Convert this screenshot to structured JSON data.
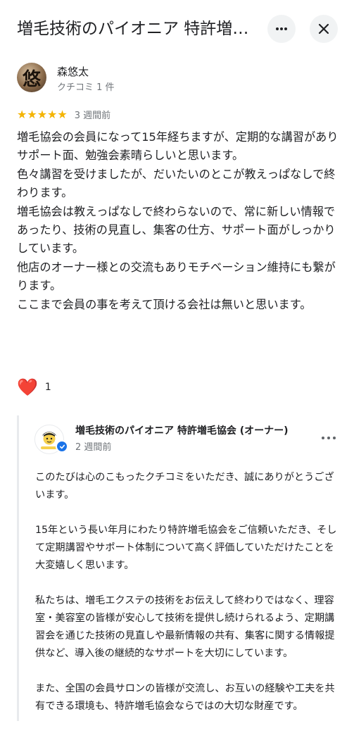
{
  "header": {
    "title": "増毛技術のパイオニア 特許増毛協会（オーナー）",
    "more_icon": "more-horizontal-icon",
    "close_icon": "close-icon"
  },
  "reviewer": {
    "avatar_text": "悠",
    "name": "森悠太",
    "count": "クチコミ 1 件"
  },
  "rating": {
    "stars": 5,
    "stars_text": "★★★★★",
    "date": "3 週間前"
  },
  "review": {
    "text": "増毛協会の会員になって15年経ちますが、定期的な講習がありサポート面、勉強会素晴らしいと思います。\n色々講習を受けましたが、だいたいのとこが教えっぱなしで終わります。\n増毛協会は教えっぱなしで終わらないので、常に新しい情報であったり、技術の見直し、集客の仕方、サポート面がしっかりしています。\n他店のオーナー様との交流もありモチベーション維持にも繋がります。\nここまで会員の事を考えて頂ける会社は無いと思います。"
  },
  "reaction": {
    "icon": "heart-icon",
    "count": "1"
  },
  "owner_reply": {
    "name": "増毛技術のパイオニア 特許増毛協会 (オーナー)",
    "date": "2 週間前",
    "paragraphs": [
      "このたびは心のこもったクチコミをいただき、誠にありがとうございます。",
      "15年という長い年月にわたり特許増毛協会をご信頼いただき、そして定期講習やサポート体制について高く評価していただけたことを大変嬉しく思います。",
      "私たちは、増毛エクステの技術をお伝えして終わりではなく、理容室・美容室の皆様が安心して技術を提供し続けられるよう、定期講習会を通じた技術の見直しや最新情報の共有、集客に関する情報提供など、導入後の継続的なサポートを大切にしています。",
      "また、全国の会員サロンの皆様が交流し、お互いの経験や工夫を共有できる環境も、特許増毛協会ならではの大切な財産です。"
    ]
  },
  "colors": {
    "star": "#f4b400",
    "heart": "#e0245e",
    "verified": "#1a73e8",
    "secondary_text": "#70757a"
  }
}
